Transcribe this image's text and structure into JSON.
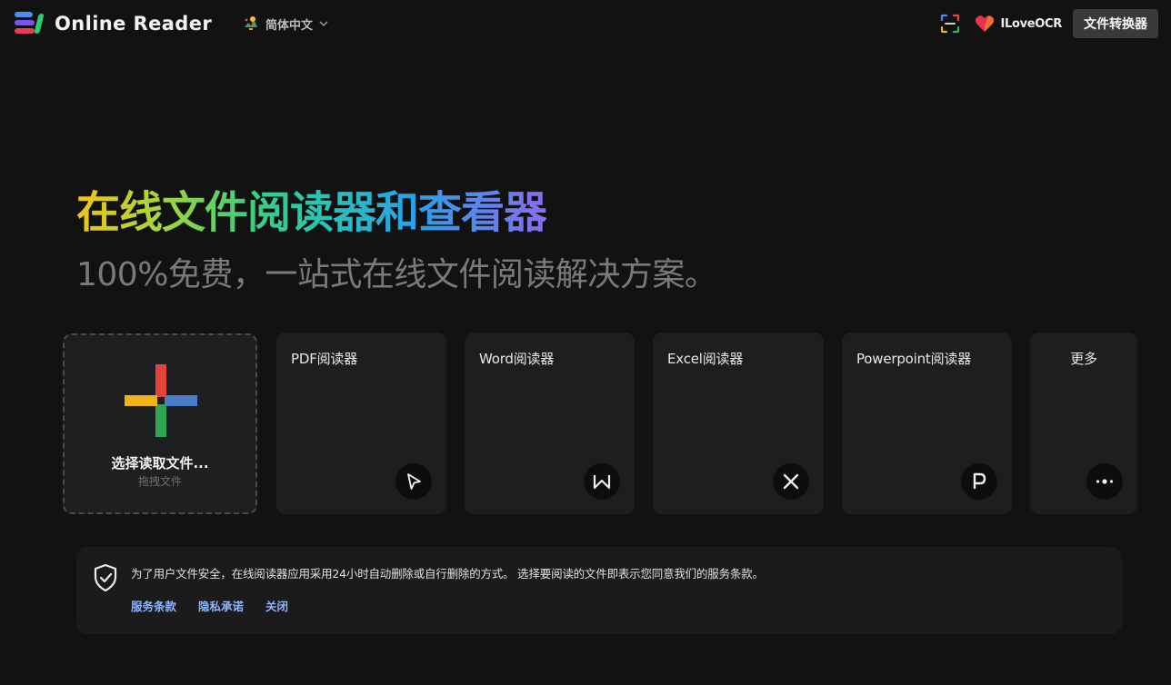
{
  "header": {
    "logo_text": "Online Reader",
    "language": {
      "label": "简体中文",
      "icon": "globe-pin-icon"
    },
    "iloveocr_label": "ILoveOCR",
    "convert_button": "文件转换器"
  },
  "hero": {
    "title": "在线文件阅读器和查看器",
    "subtitle": "100%免费，一站式在线文件阅读解决方案。"
  },
  "upload": {
    "label": "选择读取文件...",
    "hint": "拖拽文件"
  },
  "cards": [
    {
      "title": "PDF阅读器",
      "icon": "cursor-arrow-icon"
    },
    {
      "title": "Word阅读器",
      "icon": "letter-w-icon"
    },
    {
      "title": "Excel阅读器",
      "icon": "letter-x-icon"
    },
    {
      "title": "Powerpoint阅读器",
      "icon": "letter-p-icon"
    },
    {
      "title": "更多",
      "icon": "more-dots-icon"
    }
  ],
  "notice": {
    "text": "为了用户文件安全，在线阅读器应用采用24小时自动删除或自行删除的方式。 选择要阅读的文件即表示您同意我们的服务条款。",
    "links": [
      "服务条款",
      "隐私承诺",
      "关闭"
    ]
  },
  "colors": {
    "background": "#121212",
    "card": "#1d1e20",
    "link": "#8fb4ff",
    "title_gradient": [
      "#f0c419",
      "#3fcf7a",
      "#2aa0e8",
      "#8b6cf2"
    ]
  }
}
